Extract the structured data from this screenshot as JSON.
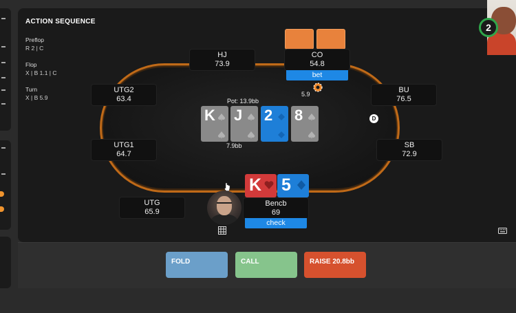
{
  "action_sequence": {
    "title": "ACTION SEQUENCE",
    "streets": [
      {
        "name": "Preflop",
        "actions": "R 2 | C"
      },
      {
        "name": "Flop",
        "actions": "X | B 1.1 | C"
      },
      {
        "name": "Turn",
        "actions": "X | B 5.9"
      }
    ]
  },
  "seats": {
    "hj": {
      "name": "HJ",
      "stack": "73.9"
    },
    "co": {
      "name": "CO",
      "stack": "54.8",
      "badge": "bet"
    },
    "utg2": {
      "name": "UTG2",
      "stack": "63.4"
    },
    "bu": {
      "name": "BU",
      "stack": "76.5"
    },
    "utg1": {
      "name": "UTG1",
      "stack": "64.7"
    },
    "sb": {
      "name": "SB",
      "stack": "72.9"
    },
    "utg": {
      "name": "UTG",
      "stack": "65.9"
    },
    "hero": {
      "name": "Bencb",
      "stack": "69",
      "badge": "check"
    }
  },
  "pot": {
    "label": "Pot: 13.9bb",
    "bottom": "7.9bb"
  },
  "bet_amount": "5.9",
  "dealer_button": "D",
  "board": [
    {
      "rank": "K",
      "suit": "spade",
      "color": "gray"
    },
    {
      "rank": "J",
      "suit": "spade",
      "color": "gray"
    },
    {
      "rank": "2",
      "suit": "diamond",
      "color": "blue"
    },
    {
      "rank": "8",
      "suit": "spade",
      "color": "gray"
    }
  ],
  "hero_cards": [
    {
      "rank": "K",
      "suit": "heart",
      "color": "#d23a3a"
    },
    {
      "rank": "5",
      "suit": "diamond",
      "color": "#1e7fd8"
    }
  ],
  "timer": "2",
  "buttons": {
    "fold": "FOLD",
    "call": "CALL",
    "raise": "RAISE 20.8bb"
  },
  "colors": {
    "fold": "#6b9fc9",
    "call": "#86c48c",
    "raise": "#d6512e",
    "bet_badge": "#1e88e5",
    "table_rail": "#c06a18"
  },
  "icons": [
    "chip-icon",
    "grid-icon",
    "keyboard-icon",
    "cursor-icon"
  ]
}
